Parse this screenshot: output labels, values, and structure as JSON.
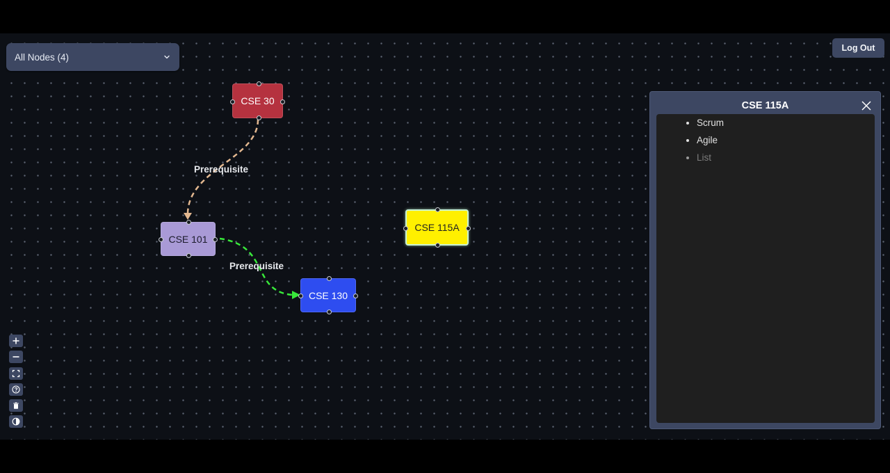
{
  "node_filter": {
    "selected_label": "All Nodes (4)"
  },
  "header": {
    "logout_label": "Log Out"
  },
  "nodes": [
    {
      "id": "cse30",
      "label": "CSE 30",
      "color": "#b5323f",
      "text_color": "#ffffff"
    },
    {
      "id": "cse101",
      "label": "CSE 101",
      "color": "#a99ad6",
      "text_color": "#1b1b2b"
    },
    {
      "id": "cse130",
      "label": "CSE 130",
      "color": "#2e4df0",
      "text_color": "#ffffff"
    },
    {
      "id": "cse115a",
      "label": "CSE 115A",
      "color": "#fff000",
      "text_color": "#222222",
      "selected": true
    }
  ],
  "edges": [
    {
      "source": "cse30",
      "target": "cse101",
      "label": "Prerequisite",
      "color": "#e3b890"
    },
    {
      "source": "cse101",
      "target": "cse130",
      "label": "Prerequisite",
      "color": "#38e83a"
    }
  ],
  "controls": [
    {
      "name": "zoom-in-button",
      "icon": "plus-icon"
    },
    {
      "name": "zoom-out-button",
      "icon": "minus-icon"
    },
    {
      "name": "fit-view-button",
      "icon": "fit-view-icon"
    },
    {
      "name": "help-button",
      "icon": "help-icon"
    },
    {
      "name": "delete-button",
      "icon": "trash-icon"
    },
    {
      "name": "theme-toggle-button",
      "icon": "contrast-icon"
    }
  ],
  "details_panel": {
    "title": "CSE 115A",
    "items": [
      "Scrum",
      "Agile"
    ],
    "placeholder": "List"
  }
}
